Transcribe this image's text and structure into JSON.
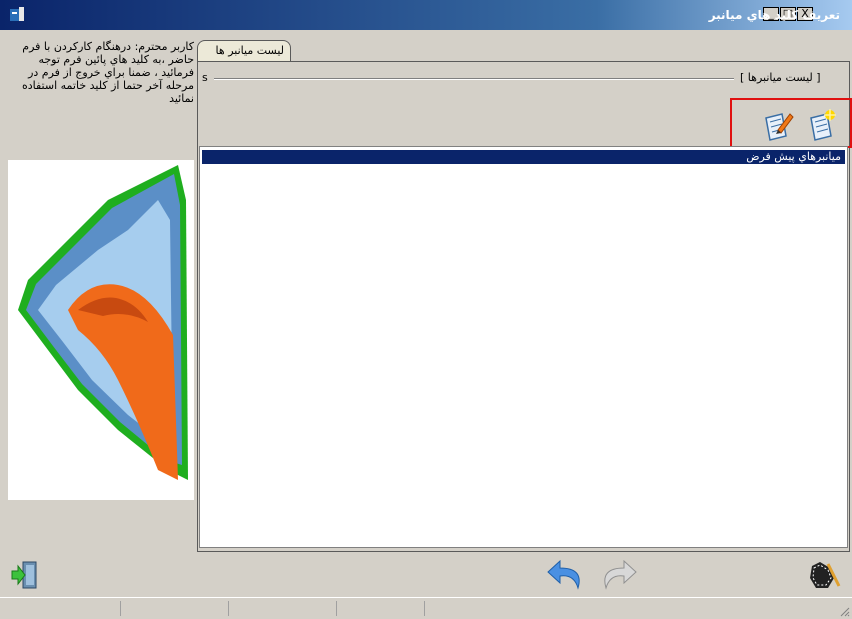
{
  "window": {
    "title": "تعريف كليد هاي ميانبر",
    "controls": {
      "close": "X",
      "maximize": "□",
      "minimize": "_"
    }
  },
  "message": "كاربر محترم: درهنگام كاركردن با فرم حاضر ،به كليد هاي پائين فرم توجه فرمائيد ، ضمنا براي خروج از فرم در مرحله آخر حتما از كليد خاتمه استفاده نمائيد",
  "tabs": [
    {
      "label": "ليست ميانبر ها"
    }
  ],
  "group": {
    "label": "[ ليست ميانبرها ]",
    "marker": "s"
  },
  "toolbar": {
    "icons": [
      "new-document-icon",
      "edit-document-icon"
    ]
  },
  "list": {
    "items": [
      {
        "label": "ميانبرهاي پيش فرض",
        "selected": true
      }
    ]
  },
  "bottom": {
    "icons": [
      "exit-icon",
      "undo-icon",
      "redo-icon",
      "tools-icon"
    ]
  },
  "colors": {
    "title_gradient_start": "#0a246a",
    "selection": "#0a246a",
    "highlight_box": "#e01010",
    "arrow_blue": "#4a90e2"
  }
}
